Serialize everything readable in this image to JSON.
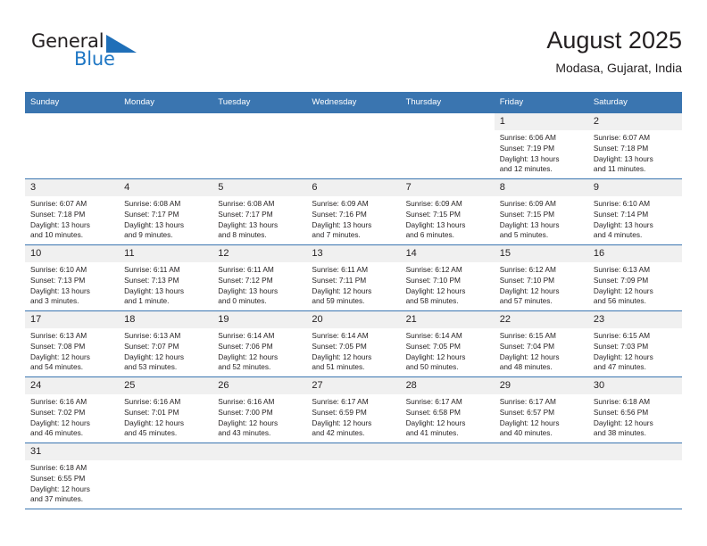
{
  "brand": {
    "word_one": "General",
    "word_two": "Blue",
    "flag_icon": "triangle-flag-icon",
    "accent_color": "#1f77c4"
  },
  "header": {
    "title": "August 2025",
    "location": "Modasa, Gujarat, India"
  },
  "theme": {
    "header_blue": "#3a75b0",
    "daynum_gray": "#f0f0f0",
    "text": "#231f20"
  },
  "calendar": {
    "weekday_headers": [
      "Sunday",
      "Monday",
      "Tuesday",
      "Wednesday",
      "Thursday",
      "Friday",
      "Saturday"
    ],
    "weeks": [
      [
        {
          "day": "",
          "empty": true,
          "blank": true,
          "sunrise": "",
          "sunset": "",
          "daylight_line1": "",
          "daylight_line2": ""
        },
        {
          "day": "",
          "empty": true,
          "blank": true,
          "sunrise": "",
          "sunset": "",
          "daylight_line1": "",
          "daylight_line2": ""
        },
        {
          "day": "",
          "empty": true,
          "blank": true,
          "sunrise": "",
          "sunset": "",
          "daylight_line1": "",
          "daylight_line2": ""
        },
        {
          "day": "",
          "empty": true,
          "blank": true,
          "sunrise": "",
          "sunset": "",
          "daylight_line1": "",
          "daylight_line2": ""
        },
        {
          "day": "",
          "empty": true,
          "blank": true,
          "sunrise": "",
          "sunset": "",
          "daylight_line1": "",
          "daylight_line2": ""
        },
        {
          "day": "1",
          "sunrise": "Sunrise: 6:06 AM",
          "sunset": "Sunset: 7:19 PM",
          "daylight_line1": "Daylight: 13 hours",
          "daylight_line2": "and 12 minutes."
        },
        {
          "day": "2",
          "sunrise": "Sunrise: 6:07 AM",
          "sunset": "Sunset: 7:18 PM",
          "daylight_line1": "Daylight: 13 hours",
          "daylight_line2": "and 11 minutes."
        }
      ],
      [
        {
          "day": "3",
          "sunrise": "Sunrise: 6:07 AM",
          "sunset": "Sunset: 7:18 PM",
          "daylight_line1": "Daylight: 13 hours",
          "daylight_line2": "and 10 minutes."
        },
        {
          "day": "4",
          "sunrise": "Sunrise: 6:08 AM",
          "sunset": "Sunset: 7:17 PM",
          "daylight_line1": "Daylight: 13 hours",
          "daylight_line2": "and 9 minutes."
        },
        {
          "day": "5",
          "sunrise": "Sunrise: 6:08 AM",
          "sunset": "Sunset: 7:17 PM",
          "daylight_line1": "Daylight: 13 hours",
          "daylight_line2": "and 8 minutes."
        },
        {
          "day": "6",
          "sunrise": "Sunrise: 6:09 AM",
          "sunset": "Sunset: 7:16 PM",
          "daylight_line1": "Daylight: 13 hours",
          "daylight_line2": "and 7 minutes."
        },
        {
          "day": "7",
          "sunrise": "Sunrise: 6:09 AM",
          "sunset": "Sunset: 7:15 PM",
          "daylight_line1": "Daylight: 13 hours",
          "daylight_line2": "and 6 minutes."
        },
        {
          "day": "8",
          "sunrise": "Sunrise: 6:09 AM",
          "sunset": "Sunset: 7:15 PM",
          "daylight_line1": "Daylight: 13 hours",
          "daylight_line2": "and 5 minutes."
        },
        {
          "day": "9",
          "sunrise": "Sunrise: 6:10 AM",
          "sunset": "Sunset: 7:14 PM",
          "daylight_line1": "Daylight: 13 hours",
          "daylight_line2": "and 4 minutes."
        }
      ],
      [
        {
          "day": "10",
          "sunrise": "Sunrise: 6:10 AM",
          "sunset": "Sunset: 7:13 PM",
          "daylight_line1": "Daylight: 13 hours",
          "daylight_line2": "and 3 minutes."
        },
        {
          "day": "11",
          "sunrise": "Sunrise: 6:11 AM",
          "sunset": "Sunset: 7:13 PM",
          "daylight_line1": "Daylight: 13 hours",
          "daylight_line2": "and 1 minute."
        },
        {
          "day": "12",
          "sunrise": "Sunrise: 6:11 AM",
          "sunset": "Sunset: 7:12 PM",
          "daylight_line1": "Daylight: 13 hours",
          "daylight_line2": "and 0 minutes."
        },
        {
          "day": "13",
          "sunrise": "Sunrise: 6:11 AM",
          "sunset": "Sunset: 7:11 PM",
          "daylight_line1": "Daylight: 12 hours",
          "daylight_line2": "and 59 minutes."
        },
        {
          "day": "14",
          "sunrise": "Sunrise: 6:12 AM",
          "sunset": "Sunset: 7:10 PM",
          "daylight_line1": "Daylight: 12 hours",
          "daylight_line2": "and 58 minutes."
        },
        {
          "day": "15",
          "sunrise": "Sunrise: 6:12 AM",
          "sunset": "Sunset: 7:10 PM",
          "daylight_line1": "Daylight: 12 hours",
          "daylight_line2": "and 57 minutes."
        },
        {
          "day": "16",
          "sunrise": "Sunrise: 6:13 AM",
          "sunset": "Sunset: 7:09 PM",
          "daylight_line1": "Daylight: 12 hours",
          "daylight_line2": "and 56 minutes."
        }
      ],
      [
        {
          "day": "17",
          "sunrise": "Sunrise: 6:13 AM",
          "sunset": "Sunset: 7:08 PM",
          "daylight_line1": "Daylight: 12 hours",
          "daylight_line2": "and 54 minutes."
        },
        {
          "day": "18",
          "sunrise": "Sunrise: 6:13 AM",
          "sunset": "Sunset: 7:07 PM",
          "daylight_line1": "Daylight: 12 hours",
          "daylight_line2": "and 53 minutes."
        },
        {
          "day": "19",
          "sunrise": "Sunrise: 6:14 AM",
          "sunset": "Sunset: 7:06 PM",
          "daylight_line1": "Daylight: 12 hours",
          "daylight_line2": "and 52 minutes."
        },
        {
          "day": "20",
          "sunrise": "Sunrise: 6:14 AM",
          "sunset": "Sunset: 7:05 PM",
          "daylight_line1": "Daylight: 12 hours",
          "daylight_line2": "and 51 minutes."
        },
        {
          "day": "21",
          "sunrise": "Sunrise: 6:14 AM",
          "sunset": "Sunset: 7:05 PM",
          "daylight_line1": "Daylight: 12 hours",
          "daylight_line2": "and 50 minutes."
        },
        {
          "day": "22",
          "sunrise": "Sunrise: 6:15 AM",
          "sunset": "Sunset: 7:04 PM",
          "daylight_line1": "Daylight: 12 hours",
          "daylight_line2": "and 48 minutes."
        },
        {
          "day": "23",
          "sunrise": "Sunrise: 6:15 AM",
          "sunset": "Sunset: 7:03 PM",
          "daylight_line1": "Daylight: 12 hours",
          "daylight_line2": "and 47 minutes."
        }
      ],
      [
        {
          "day": "24",
          "sunrise": "Sunrise: 6:16 AM",
          "sunset": "Sunset: 7:02 PM",
          "daylight_line1": "Daylight: 12 hours",
          "daylight_line2": "and 46 minutes."
        },
        {
          "day": "25",
          "sunrise": "Sunrise: 6:16 AM",
          "sunset": "Sunset: 7:01 PM",
          "daylight_line1": "Daylight: 12 hours",
          "daylight_line2": "and 45 minutes."
        },
        {
          "day": "26",
          "sunrise": "Sunrise: 6:16 AM",
          "sunset": "Sunset: 7:00 PM",
          "daylight_line1": "Daylight: 12 hours",
          "daylight_line2": "and 43 minutes."
        },
        {
          "day": "27",
          "sunrise": "Sunrise: 6:17 AM",
          "sunset": "Sunset: 6:59 PM",
          "daylight_line1": "Daylight: 12 hours",
          "daylight_line2": "and 42 minutes."
        },
        {
          "day": "28",
          "sunrise": "Sunrise: 6:17 AM",
          "sunset": "Sunset: 6:58 PM",
          "daylight_line1": "Daylight: 12 hours",
          "daylight_line2": "and 41 minutes."
        },
        {
          "day": "29",
          "sunrise": "Sunrise: 6:17 AM",
          "sunset": "Sunset: 6:57 PM",
          "daylight_line1": "Daylight: 12 hours",
          "daylight_line2": "and 40 minutes."
        },
        {
          "day": "30",
          "sunrise": "Sunrise: 6:18 AM",
          "sunset": "Sunset: 6:56 PM",
          "daylight_line1": "Daylight: 12 hours",
          "daylight_line2": "and 38 minutes."
        }
      ],
      [
        {
          "day": "31",
          "sunrise": "Sunrise: 6:18 AM",
          "sunset": "Sunset: 6:55 PM",
          "daylight_line1": "Daylight: 12 hours",
          "daylight_line2": "and 37 minutes."
        },
        {
          "day": "",
          "empty": true,
          "sunrise": "",
          "sunset": "",
          "daylight_line1": "",
          "daylight_line2": ""
        },
        {
          "day": "",
          "empty": true,
          "sunrise": "",
          "sunset": "",
          "daylight_line1": "",
          "daylight_line2": ""
        },
        {
          "day": "",
          "empty": true,
          "sunrise": "",
          "sunset": "",
          "daylight_line1": "",
          "daylight_line2": ""
        },
        {
          "day": "",
          "empty": true,
          "sunrise": "",
          "sunset": "",
          "daylight_line1": "",
          "daylight_line2": ""
        },
        {
          "day": "",
          "empty": true,
          "sunrise": "",
          "sunset": "",
          "daylight_line1": "",
          "daylight_line2": ""
        },
        {
          "day": "",
          "empty": true,
          "sunrise": "",
          "sunset": "",
          "daylight_line1": "",
          "daylight_line2": ""
        }
      ]
    ]
  }
}
